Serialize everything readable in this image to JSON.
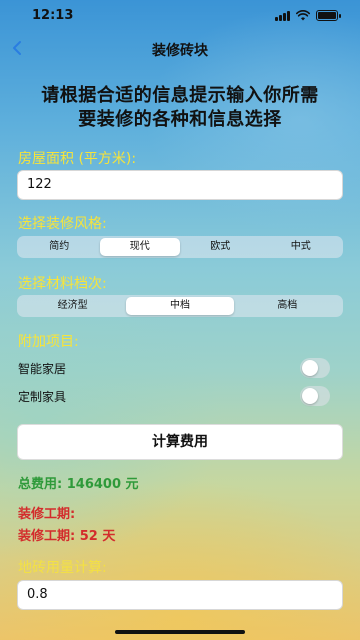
{
  "status_bar": {
    "time": "12:13"
  },
  "nav": {
    "title": "装修砖块"
  },
  "heading": {
    "line1": "请根据合适的信息提示输入你所需",
    "line2": "要装修的各种和信息选择"
  },
  "area": {
    "label": "房屋面积 (平方米):",
    "value": "122"
  },
  "style": {
    "label": "选择装修风格:",
    "options": [
      "简约",
      "现代",
      "欧式",
      "中式"
    ],
    "selected": "现代"
  },
  "material": {
    "label": "选择材料档次:",
    "options": [
      "经济型",
      "中档",
      "高档"
    ],
    "selected": "中档"
  },
  "extras": {
    "label": "附加项目:",
    "items": [
      {
        "label": "智能家居",
        "on": false
      },
      {
        "label": "定制家具",
        "on": false
      }
    ]
  },
  "calculate_button": {
    "label": "计算费用"
  },
  "results": {
    "total_cost": "总费用: 146400 元",
    "duration_label": "装修工期:",
    "duration_value": "装修工期: 52 天"
  },
  "tile": {
    "label": "地砖用量计算:",
    "value": "0.8"
  }
}
